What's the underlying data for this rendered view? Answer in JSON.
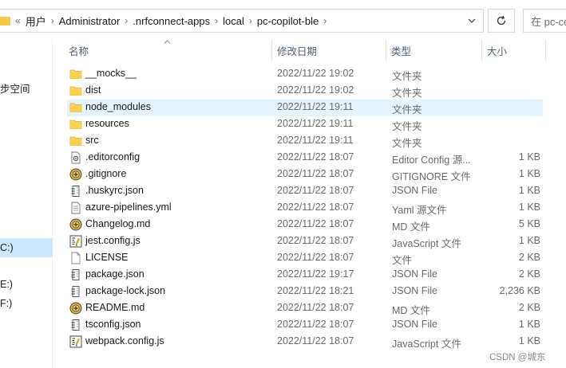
{
  "address_bar": {
    "overflow_glyph": "«",
    "breadcrumbs": [
      "用户",
      "Administrator",
      ".nrfconnect-apps",
      "local",
      "pc-copilot-ble"
    ],
    "separator": "›",
    "search_text": "在 pc-copilot-ble 中搜索"
  },
  "nav_pane": {
    "items": [
      {
        "label": "步空间"
      },
      {
        "label": "C:)"
      },
      {
        "label": "E:)"
      },
      {
        "label": "F:)"
      }
    ]
  },
  "columns": {
    "name": "名称",
    "date": "修改日期",
    "type": "类型",
    "size": "大小"
  },
  "files": [
    {
      "name": "__mocks__",
      "date": "2022/11/22 19:02",
      "type": "文件夹",
      "size": "",
      "icon": "folder-icon"
    },
    {
      "name": "dist",
      "date": "2022/11/22 19:02",
      "type": "文件夹",
      "size": "",
      "icon": "folder-icon"
    },
    {
      "name": "node_modules",
      "date": "2022/11/22 19:11",
      "type": "文件夹",
      "size": "",
      "icon": "folder-icon"
    },
    {
      "name": "resources",
      "date": "2022/11/22 19:11",
      "type": "文件夹",
      "size": "",
      "icon": "folder-icon"
    },
    {
      "name": "src",
      "date": "2022/11/22 19:11",
      "type": "文件夹",
      "size": "",
      "icon": "folder-icon"
    },
    {
      "name": ".editorconfig",
      "date": "2022/11/22 18:07",
      "type": "Editor Config 源...",
      "size": "1 KB",
      "icon": "config-file-icon"
    },
    {
      "name": ".gitignore",
      "date": "2022/11/22 18:07",
      "type": "GITIGNORE 文件",
      "size": "1 KB",
      "icon": "gold-badge-file-icon"
    },
    {
      "name": ".huskyrc.json",
      "date": "2022/11/22 18:07",
      "type": "JSON File",
      "size": "1 KB",
      "icon": "json-file-icon"
    },
    {
      "name": "azure-pipelines.yml",
      "date": "2022/11/22 18:07",
      "type": "Yaml 源文件",
      "size": "1 KB",
      "icon": "text-file-icon"
    },
    {
      "name": "Changelog.md",
      "date": "2022/11/22 18:07",
      "type": "MD 文件",
      "size": "5 KB",
      "icon": "gold-badge-file-icon"
    },
    {
      "name": "jest.config.js",
      "date": "2022/11/22 18:07",
      "type": "JavaScript 文件",
      "size": "1 KB",
      "icon": "script-file-icon"
    },
    {
      "name": "LICENSE",
      "date": "2022/11/22 18:07",
      "type": "文件",
      "size": "2 KB",
      "icon": "blank-file-icon"
    },
    {
      "name": "package.json",
      "date": "2022/11/22 19:17",
      "type": "JSON File",
      "size": "2 KB",
      "icon": "json-file-icon"
    },
    {
      "name": "package-lock.json",
      "date": "2022/11/22 18:21",
      "type": "JSON File",
      "size": "2,236 KB",
      "icon": "json-file-icon"
    },
    {
      "name": "README.md",
      "date": "2022/11/22 18:07",
      "type": "MD 文件",
      "size": "2 KB",
      "icon": "gold-badge-file-icon"
    },
    {
      "name": "tsconfig.json",
      "date": "2022/11/22 18:07",
      "type": "JSON File",
      "size": "1 KB",
      "icon": "json-file-icon"
    },
    {
      "name": "webpack.config.js",
      "date": "2022/11/22 18:07",
      "type": "JavaScript 文件",
      "size": "1 KB",
      "icon": "script-file-icon"
    }
  ],
  "selected_file": "node_modules",
  "watermark": "CSDN @城东",
  "colors": {
    "folder": "#f7c948",
    "selection": "#e5f3ff",
    "nav_selection": "#cce8ff",
    "header_text": "#4c607a"
  }
}
